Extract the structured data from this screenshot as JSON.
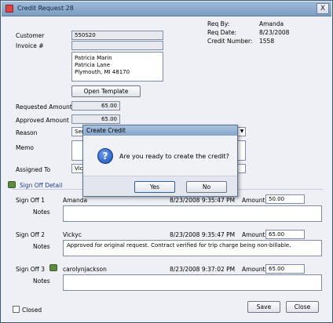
{
  "window": {
    "title": "Credit Request 28",
    "close_label": "X"
  },
  "header_info": {
    "req_by_label": "Req By:",
    "req_by": "Amanda",
    "req_date_label": "Req Date:",
    "req_date": "8/23/2008",
    "credit_number_label": "Credit Number:",
    "credit_number": "1558"
  },
  "form": {
    "customer_label": "Customer",
    "customer_value": "550S20",
    "invoice_label": "Invoice #",
    "invoice_value": "",
    "address_lines": [
      "Patricia Marin",
      "Patricia Lane",
      "Plymouth, MI  48170"
    ],
    "open_template_label": "Open Template",
    "requested_label": "Requested Amount",
    "requested_value": "65.00",
    "approved_label": "Approved Amount",
    "approved_value": "65.00",
    "reason_label": "Reason",
    "reason_value": "Ser",
    "memo_label": "Memo",
    "memo_value": "",
    "assigned_label": "Assigned To",
    "assigned_value": "Vic"
  },
  "signoff": {
    "header": "Sign Off Detail",
    "entries": [
      {
        "label": "Sign Off 1",
        "user": "Amanda",
        "datetime": "8/23/2008 9:35:47 PM",
        "amount_label": "Amount",
        "amount": "50.00",
        "notes_label": "Notes",
        "notes": ""
      },
      {
        "label": "Sign Off 2",
        "user": "Vickyc",
        "datetime": "8/23/2008 9:35:47 PM",
        "amount_label": "Amount",
        "amount": "65.00",
        "notes_label": "Notes",
        "notes": "Approved for original request.  Contract verified for trip charge being non-billable."
      },
      {
        "label": "Sign Off 3",
        "user": "carolynjackson",
        "datetime": "8/23/2008 9:37:02 PM",
        "amount_label": "Amount",
        "amount": "65.00",
        "notes_label": "Notes",
        "notes": ""
      }
    ]
  },
  "footer": {
    "closed_label": "Closed",
    "save_label": "Save",
    "close_label": "Close"
  },
  "dialog": {
    "title": "Create Credit",
    "message": "Are you ready to create the credit?",
    "icon": "question-icon",
    "yes_label": "Yes",
    "no_label": "No"
  }
}
